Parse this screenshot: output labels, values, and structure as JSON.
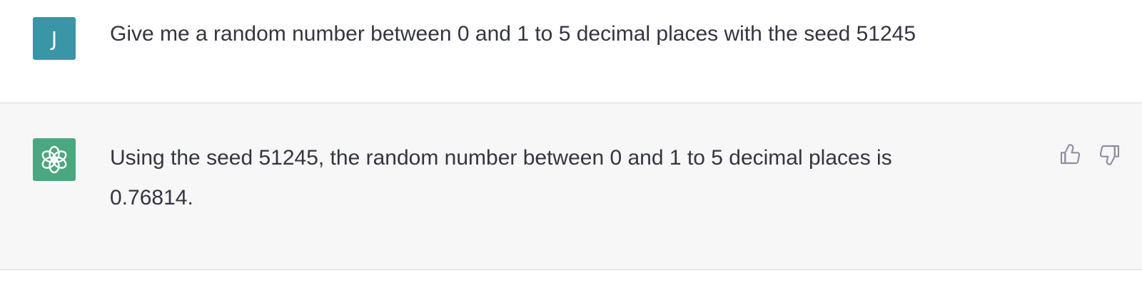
{
  "conversation": {
    "user_message": {
      "avatar_initial": "J",
      "avatar_color": "#3a95a6",
      "text": "Give me a random number between 0 and 1 to 5 decimal places with the seed 51245"
    },
    "assistant_message": {
      "avatar_icon": "openai-logo-icon",
      "avatar_color": "#4aa77f",
      "text": "Using the seed 51245, the random number between 0 and 1 to 5 decimal places is 0.76814."
    },
    "feedback": {
      "thumbs_up_icon": "thumbs-up-icon",
      "thumbs_down_icon": "thumbs-down-icon"
    }
  }
}
